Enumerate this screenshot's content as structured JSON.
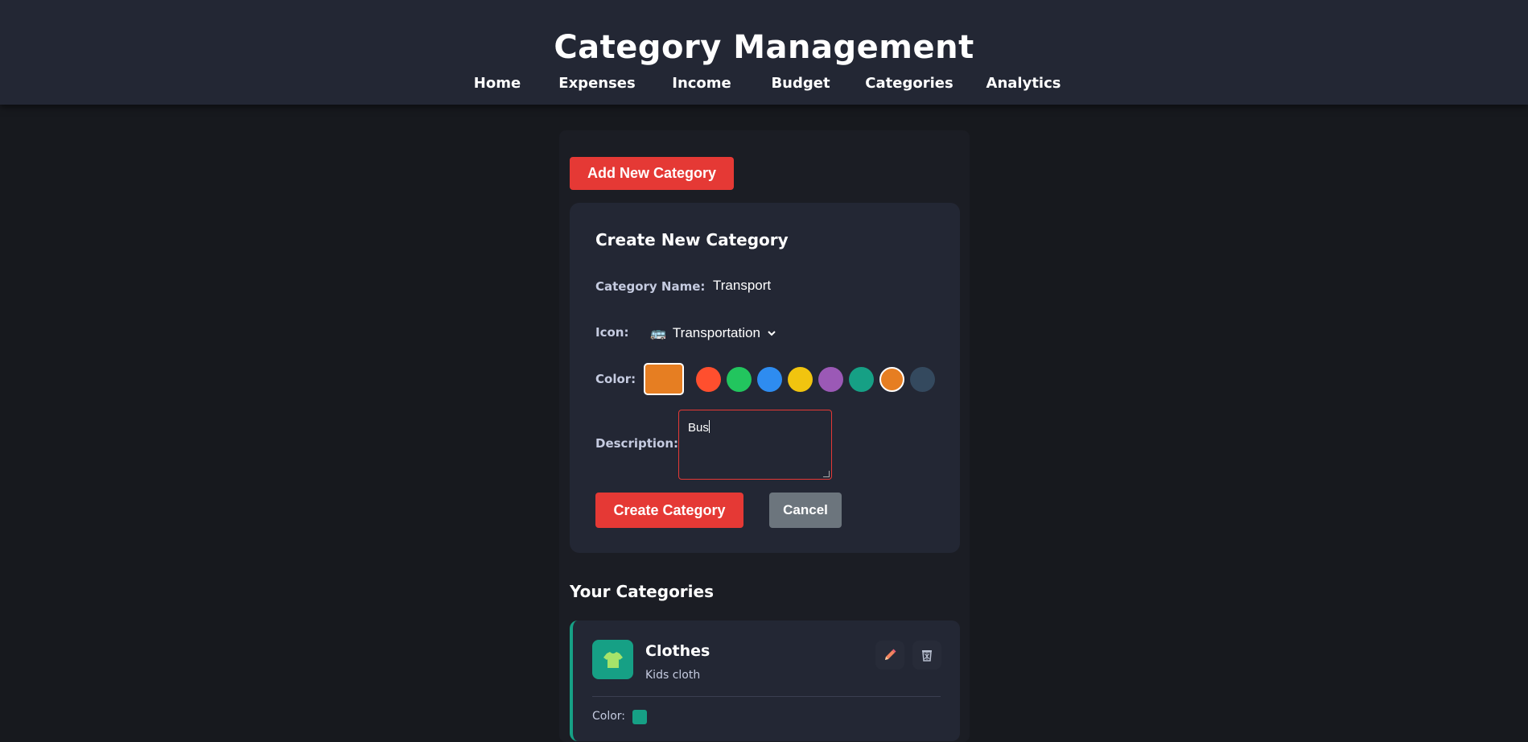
{
  "header": {
    "title": "Category Management",
    "nav": [
      "Home",
      "Expenses",
      "Income",
      "Budget",
      "Categories",
      "Analytics"
    ]
  },
  "add_button_label": "Add New Category",
  "form": {
    "title": "Create New Category",
    "name_label": "Category Name:",
    "name_value": "Transport",
    "icon_label": "Icon:",
    "icon_value": "Transportation",
    "icon_glyph": "🚌",
    "color_label": "Color:",
    "selected_color": "#e67e22",
    "swatches": [
      "#ff4f2e",
      "#22c55e",
      "#2e8cf0",
      "#f1c40f",
      "#9b59b6",
      "#16a085",
      "#e67e22",
      "#34495e"
    ],
    "description_label": "Description:",
    "description_value": "Bus",
    "create_label": "Create Category",
    "cancel_label": "Cancel"
  },
  "categories_section": {
    "title": "Your Categories",
    "items": [
      {
        "name": "Clothes",
        "description": "Kids cloth",
        "color_label": "Color:",
        "color": "#16a085",
        "icon": "tshirt-icon"
      }
    ]
  },
  "colors": {
    "accent": "#e53935",
    "header_bg": "#232734",
    "page_bg": "#17191e",
    "cancel_bg": "#6c757d"
  }
}
